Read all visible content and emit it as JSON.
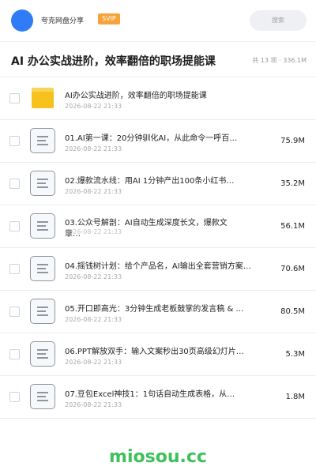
{
  "header": {
    "site_name": "夸克网盘分享",
    "badge": "SVIP",
    "search_placeholder": "搜索"
  },
  "title_bar": {
    "title": "AI 办公实战进阶，效率翻倍的职场提能课",
    "count": "共 13 项 · 336.1M"
  },
  "files": [
    {
      "type": "folder",
      "name": "AI办公实战进阶，效率翻倍的职场提能课",
      "date": "2026-08-22 21:33",
      "size": ""
    },
    {
      "type": "doc",
      "name": "01.AI第一课：20分钟驯化AI，从此命令一呼百…",
      "date": "2026-08-22 21:33",
      "size": "75.9M"
    },
    {
      "type": "doc",
      "name": "02.爆款流水线：用AI 1分钟产出100条小红书…",
      "date": "2026-08-22 21:33",
      "size": "35.2M"
    },
    {
      "type": "doc",
      "name": "03.公众号解剖：AI自动生成深度长文，爆款文章…",
      "date": "2026-08-22 21:33",
      "size": "56.1M",
      "wrap": true
    },
    {
      "type": "doc",
      "name": "04.摇钱树计划：给个产品名，AI输出全套营销方案…",
      "date": "2026-08-22 21:33",
      "size": "70.6M"
    },
    {
      "type": "doc",
      "name": "05.开口即高光：3分钟生成老板鼓掌的发言稿 & …",
      "date": "2026-08-22 21:33",
      "size": "80.5M"
    },
    {
      "type": "doc",
      "name": "06.PPT解放双手：输入文案秒出30页高级幻灯片…",
      "date": "2026-08-22 21:33",
      "size": "5.3M"
    },
    {
      "type": "doc",
      "name": "07.豆包Excel神技1：1句话自动生成表格，从…",
      "date": "2026-08-22 21:33",
      "size": "1.8M"
    }
  ],
  "watermark": "miosou.cc",
  "colors": {
    "accent": "#2f7cf6",
    "badge": "#f7a23a",
    "watermark": "#3ec05a",
    "folder": "#f8c21d"
  }
}
